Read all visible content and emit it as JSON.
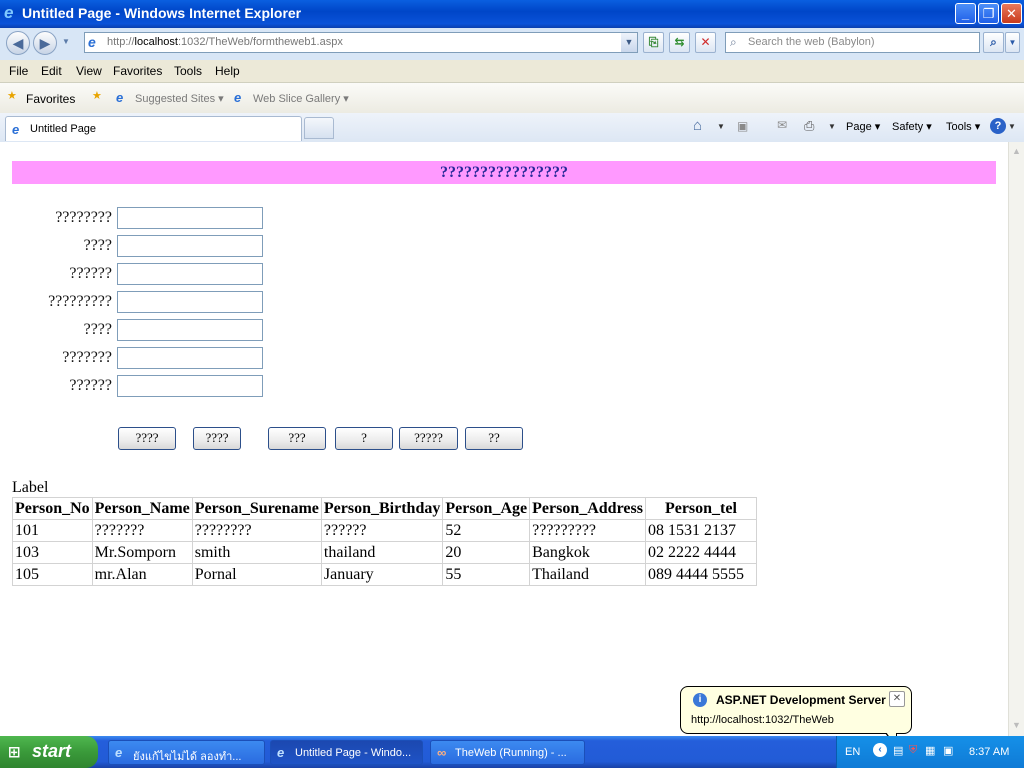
{
  "window": {
    "title": "Untitled Page - Windows Internet Explorer",
    "minimize": "_",
    "restore": "❐",
    "close": "✕"
  },
  "addressbar": {
    "url_prefix": "http://",
    "url_host": "localhost",
    "url_rest": ":1032/TheWeb/formtheweb1.aspx",
    "search_placeholder": "Search the web (Babylon)"
  },
  "menu": [
    "File",
    "Edit",
    "View",
    "Favorites",
    "Tools",
    "Help"
  ],
  "favorites": {
    "label": "Favorites",
    "suggested": "Suggested Sites ▾",
    "webslice": "Web Slice Gallery ▾"
  },
  "tab": {
    "label": "Untitled Page"
  },
  "commandbar": {
    "page": "Page ▾",
    "safety": "Safety ▾",
    "tools": "Tools ▾",
    "help": "?"
  },
  "page": {
    "header": "????????????????",
    "fields": [
      {
        "label": "????????",
        "value": ""
      },
      {
        "label": "????",
        "value": ""
      },
      {
        "label": "??????",
        "value": ""
      },
      {
        "label": "?????????",
        "value": ""
      },
      {
        "label": "????",
        "value": ""
      },
      {
        "label": "???????",
        "value": ""
      },
      {
        "label": "??????",
        "value": ""
      }
    ],
    "buttons": [
      "????",
      "????",
      "???",
      "?",
      "?????",
      "??"
    ],
    "label": "Label",
    "table": {
      "headers": [
        "Person_No",
        "Person_Name",
        "Person_Surename",
        "Person_Birthday",
        "Person_Age",
        "Person_Address",
        "Person_tel"
      ],
      "rows": [
        [
          "101",
          "???????",
          "????????",
          "??????",
          "52",
          "?????????",
          "08 1531 2137"
        ],
        [
          "103",
          "Mr.Somporn",
          "smith",
          "thailand",
          "20",
          "Bangkok",
          "02 2222 4444"
        ],
        [
          "105",
          "mr.Alan",
          "Pornal",
          "January",
          "55",
          "Thailand",
          "089 4444 5555"
        ]
      ]
    }
  },
  "balloon": {
    "title": "ASP.NET Development Server",
    "url": "http://localhost:1032/TheWeb"
  },
  "taskbar": {
    "start": "start",
    "tasks": [
      "ยังแก้ไขไม่ได้ ลองทำ...",
      "Untitled Page - Windo...",
      "TheWeb (Running) - ..."
    ],
    "lang": "EN",
    "clock": "8:37 AM"
  }
}
